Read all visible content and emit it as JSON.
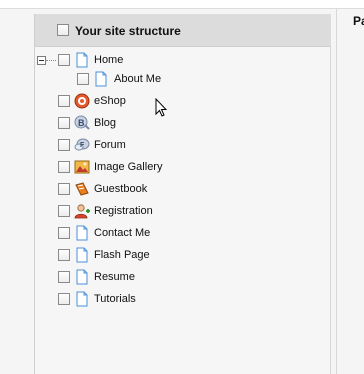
{
  "panel": {
    "header_title": "Your site structure",
    "right_label": "Pa"
  },
  "tree": {
    "items": [
      {
        "label": "Home",
        "icon": "page-icon"
      },
      {
        "label": "About Me",
        "icon": "page-icon"
      },
      {
        "label": "eShop",
        "icon": "eshop-icon"
      },
      {
        "label": "Blog",
        "icon": "blog-icon"
      },
      {
        "label": "Forum",
        "icon": "forum-icon"
      },
      {
        "label": "Image Gallery",
        "icon": "image-gallery-icon"
      },
      {
        "label": "Guestbook",
        "icon": "guestbook-icon"
      },
      {
        "label": "Registration",
        "icon": "registration-icon"
      },
      {
        "label": "Contact Me",
        "icon": "page-icon"
      },
      {
        "label": "Flash Page",
        "icon": "page-icon"
      },
      {
        "label": "Resume",
        "icon": "page-icon"
      },
      {
        "label": "Tutorials",
        "icon": "page-icon"
      }
    ]
  },
  "colors": {
    "header_bg": "#dcdcdc",
    "panel_bg": "#f6f6f6",
    "page_icon_stroke": "#4a90d9"
  }
}
